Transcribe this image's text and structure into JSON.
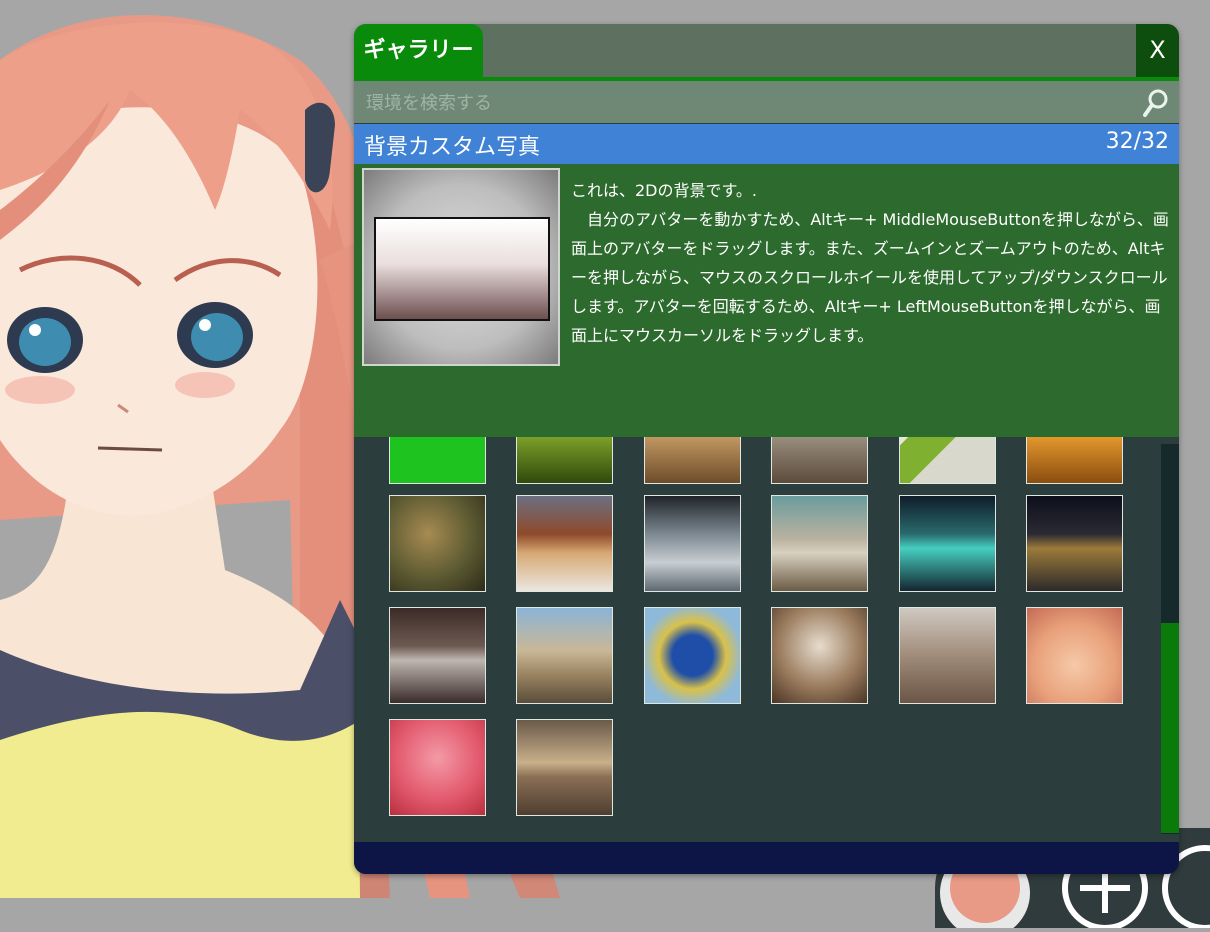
{
  "gallery": {
    "tab_label": "ギャラリー",
    "close_label": "X",
    "search": {
      "placeholder": "環境を検索する",
      "value": ""
    },
    "header": {
      "title": "背景カスタム写真",
      "count": "32/32"
    },
    "detail": {
      "line1": "これは、2Dの背景です。.",
      "line2": "　自分のアバターを動かすため、Altキー+ MiddleMouseButtonを押しながら、画面上のアバターをドラッグします。また、ズームインとズームアウトのため、Altキーを押しながら、マウスのスクロールホイールを使用してアップ/ダウンスクロールします。アバターを回転するため、Altキー+ LeftMouseButtonを押しながら、画面上にマウスカーソルをドラッグします。"
    },
    "thumbnails": [
      {
        "name": "green-screen",
        "bg": "#1fc31f"
      },
      {
        "name": "forest-moss",
        "bg": "linear-gradient(#4a6b12,#7fa22a 50%,#2f4a0c)"
      },
      {
        "name": "wood-room",
        "bg": "linear-gradient(#8d6a3a,#c49963 50%,#6e4d2b)"
      },
      {
        "name": "building-window",
        "bg": "linear-gradient(#d9d5cc,#a79d8e 40%,#5c4b3b)"
      },
      {
        "name": "green-tiles",
        "bg": "linear-gradient(135deg,#e6e6d9 30%,#7fb030 30%,#7fb030 55%,#d8d8cc 55%)"
      },
      {
        "name": "autumn-orange",
        "bg": "linear-gradient(#c66a18,#e69a2e 50%,#8a4d10)"
      },
      {
        "name": "autumn-path",
        "bg": "radial-gradient(circle at 40% 40%,#a78b52,#5c5a32 55%,#2d2b17)"
      },
      {
        "name": "snowy-lodge",
        "bg": "linear-gradient(#6c6f82,#8e4a2a 40%,#d7a874 60%,#eae7e0)"
      },
      {
        "name": "stage-lights",
        "bg": "linear-gradient(#20242a,#7d8891 40%,#c7ced3 70%,#5e6870)"
      },
      {
        "name": "sunny-street",
        "bg": "linear-gradient(#6a9c9e,#b9b2a0 45%,#d8d0c0 60%,#6a5b45)"
      },
      {
        "name": "neon-city",
        "bg": "linear-gradient(#0f1d2a,#2a6a6e 40%,#46cfc0 55%,#142530)"
      },
      {
        "name": "night-plaza",
        "bg": "linear-gradient(#0c0f1a,#2b2a33 40%,#9c7a3a 55%,#2d2a2a)"
      },
      {
        "name": "trees-silhouette",
        "bg": "linear-gradient(#3b2a26,#6d5a52 40%,#bfb6b0 55%,#3a2c29)"
      },
      {
        "name": "old-street",
        "bg": "linear-gradient(#8bb4d6,#c9b796 45%,#9a8462 70%,#5b4d3b)"
      },
      {
        "name": "oktoberfest",
        "bg": "radial-gradient(circle,#1f4ea8 30%,#d9c14a 50%,#8fb9d9 75%)"
      },
      {
        "name": "arched-hall",
        "bg": "radial-gradient(circle at 50% 40%,#e6dccd,#9b7c5e 55%,#4a3526)"
      },
      {
        "name": "bare-trees-road",
        "bg": "linear-gradient(#cfc9c2,#a08c7a 50%,#6b5546)"
      },
      {
        "name": "hearts-balloons",
        "bg": "radial-gradient(circle at 50% 60%,#f6c9a8,#e8a07a 55%,#c46a55)"
      },
      {
        "name": "pink-bokeh",
        "bg": "radial-gradient(circle at 50% 40%,#f39aa7,#e35b6e 55%,#b8303f)"
      },
      {
        "name": "sunny-cafe",
        "bg": "linear-gradient(#6b5a4a,#c9b08a 45%,#8a6f55 60%,#4e3e30)"
      }
    ]
  }
}
